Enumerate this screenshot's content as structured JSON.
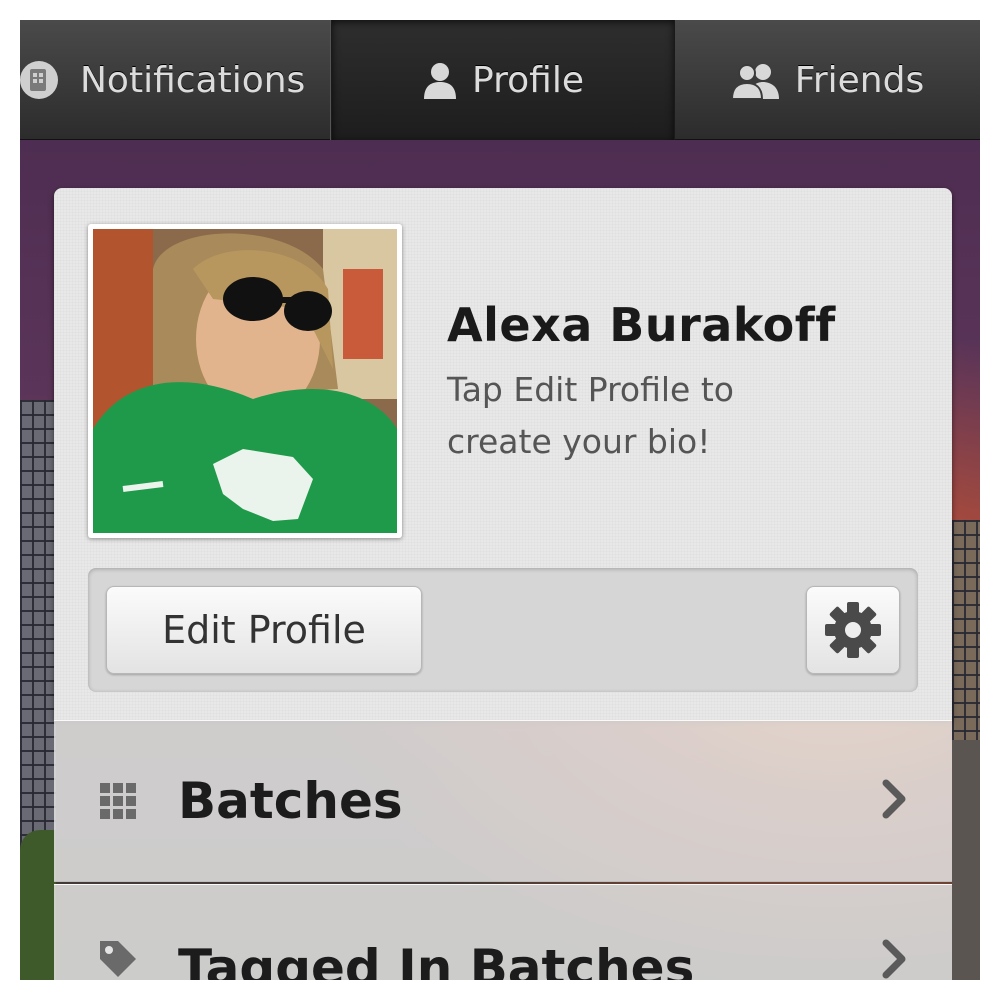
{
  "tabs": [
    {
      "label": "Notifications",
      "icon": "notifications-icon"
    },
    {
      "label": "Profile",
      "icon": "person-icon",
      "selected": true
    },
    {
      "label": "Friends",
      "icon": "friends-icon"
    }
  ],
  "profile": {
    "name": "Alexa Burakoff",
    "bio_line1": "Tap Edit Profile to",
    "bio_line2": "create your bio!"
  },
  "actions": {
    "edit_profile_label": "Edit Profile",
    "settings_icon": "gear-icon"
  },
  "list": [
    {
      "label": "Batches",
      "icon": "grid-icon"
    },
    {
      "label": "Tagged In Batches",
      "icon": "tag-icon"
    }
  ],
  "colors": {
    "tabbar": "#2c2c2c",
    "card": "#e8e8e8",
    "text_primary": "#1a1a1a",
    "text_secondary": "#555555"
  }
}
